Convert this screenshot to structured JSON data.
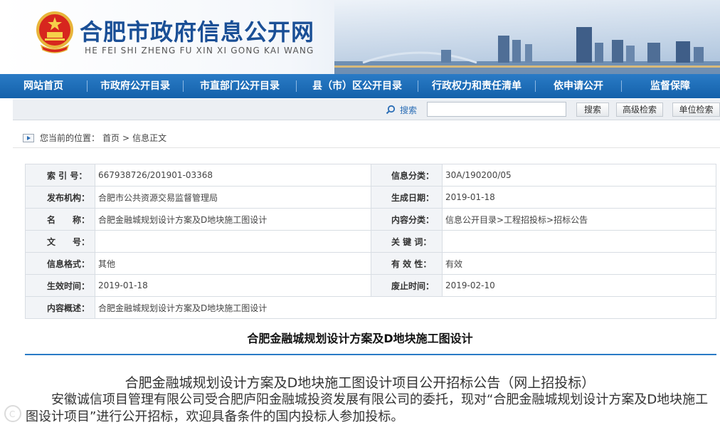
{
  "header": {
    "title": "合肥市政府信息公开网",
    "pinyin": "HE FEI SHI ZHENG FU XIN XI GONG KAI WANG",
    "emblem_icon": "national-emblem-icon"
  },
  "nav": {
    "items": [
      {
        "label": "网站首页"
      },
      {
        "label": "市政府公开目录"
      },
      {
        "label": "市直部门公开目录"
      },
      {
        "label": "县（市）区公开目录"
      },
      {
        "label": "行政权力和责任清单"
      },
      {
        "label": "依申请公开"
      },
      {
        "label": "监督保障"
      }
    ]
  },
  "search": {
    "label": "搜索",
    "placeholder": "",
    "buttons": {
      "search": "搜索",
      "advanced": "高级检索",
      "unit": "单位检索"
    }
  },
  "breadcrumb": {
    "prefix": "您当前的位置：",
    "home": "首页",
    "sep": ">",
    "current": "信息正文"
  },
  "info": {
    "index_no_label": "索 引 号：",
    "index_no": "667938726/201901-03368",
    "category_label": "信息分类：",
    "category": "30A/190200/05",
    "publisher_label": "发布机构：",
    "publisher": "合肥市公共资源交易监督管理局",
    "created_label": "生成日期：",
    "created": "2019-01-18",
    "name_label": "名　　称：",
    "name": "合肥金融城规划设计方案及D地块施工图设计",
    "content_cat_label": "内容分类：",
    "content_cat": "信息公开目录>工程招投标>招标公告",
    "doc_no_label": "文　　号：",
    "doc_no": "",
    "keywords_label": "关 键 词：",
    "keywords": "",
    "format_label": "信息格式：",
    "format": "其他",
    "validity_label": "有 效 性：",
    "validity": "有效",
    "effective_label": "生效时间：",
    "effective": "2019-01-18",
    "expiry_label": "废止时间：",
    "expiry": "2019-02-10",
    "summary_label": "内容概述：",
    "summary": "合肥金融城规划设计方案及D地块施工图设计"
  },
  "article": {
    "title": "合肥金融城规划设计方案及D地块施工图设计",
    "subtitle": "合肥金融城规划设计方案及D地块施工图设计项目公开招标公告（网上招投标）",
    "body": "安徽诚信项目管理有限公司受合肥庐阳金融城投资发展有限公司的委托，现对“合肥金融城规划设计方案及D地块施工图设计项目”进行公开招标，欢迎具备条件的国内投标人参加投标。"
  },
  "colors": {
    "brand": "#1a4f96",
    "nav": "#1461aa",
    "rule": "#2a7bc6"
  }
}
